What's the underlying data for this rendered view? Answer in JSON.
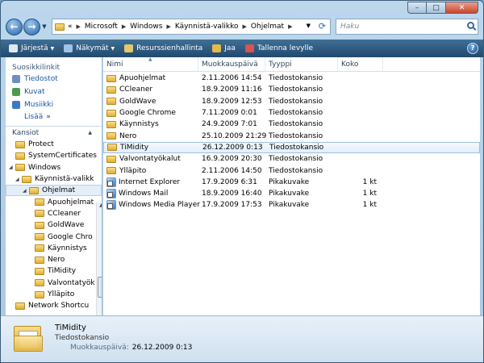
{
  "window": {
    "caption": {
      "minimize": "–",
      "maximize": "□",
      "close": "✕"
    }
  },
  "nav": {
    "back_label": "←",
    "forward_label": "→",
    "breadcrumb": [
      "Microsoft",
      "Windows",
      "Käynnistä-valikko",
      "Ohjelmat"
    ],
    "overflow": "«",
    "search_placeholder": "Haku"
  },
  "toolbar": {
    "items": [
      {
        "label": "Järjestä",
        "icon": "organize-icon",
        "color": "#dfe9f3",
        "caret": true
      },
      {
        "label": "Näkymät",
        "icon": "views-icon",
        "color": "#9ec3e6",
        "caret": true
      },
      {
        "label": "Resurssienhallinta",
        "icon": "explorer-icon",
        "color": "#e5c86d",
        "caret": false
      },
      {
        "label": "Jaa",
        "icon": "share-icon",
        "color": "#e8b84a",
        "caret": false
      },
      {
        "label": "Tallenna levylle",
        "icon": "burn-disc-icon",
        "color": "#d9534f",
        "caret": false
      }
    ],
    "help": "?"
  },
  "navpane": {
    "favorites_heading": "Suosikkilinkit",
    "favorites": [
      {
        "label": "Tiedostot",
        "color": "#6d8fbf"
      },
      {
        "label": "Kuvat",
        "color": "#4b9a4b"
      },
      {
        "label": "Musiikki",
        "color": "#3c78c6"
      }
    ],
    "more": "Lisää",
    "more_icon": "»",
    "folders_heading": "Kansiot",
    "tree": [
      {
        "label": "Protect",
        "indent": 1
      },
      {
        "label": "SystemCertificates",
        "indent": 1
      },
      {
        "label": "Windows",
        "indent": 1,
        "expanded": true
      },
      {
        "label": "Käynnistä-valikk",
        "indent": 2,
        "expanded": true
      },
      {
        "label": "Ohjelmat",
        "indent": 3,
        "selected": true,
        "expanded": true
      },
      {
        "label": "Apuohjelmat",
        "indent": 4
      },
      {
        "label": "CCleaner",
        "indent": 4
      },
      {
        "label": "GoldWave",
        "indent": 4
      },
      {
        "label": "Google Chro",
        "indent": 4
      },
      {
        "label": "Käynnistys",
        "indent": 4
      },
      {
        "label": "Nero",
        "indent": 4
      },
      {
        "label": "TiMidity",
        "indent": 4
      },
      {
        "label": "Valvontatyök",
        "indent": 4
      },
      {
        "label": "Ylläpito",
        "indent": 4
      },
      {
        "label": "Network Shortcu",
        "indent": 1
      }
    ]
  },
  "filelist": {
    "columns": [
      "Nimi",
      "Muokkauspäivä",
      "Tyyppi",
      "Koko"
    ],
    "rows": [
      {
        "name": "Apuohjelmat",
        "date": "2.11.2006 14:54",
        "type": "Tiedostokansio",
        "size": "",
        "kind": "folder"
      },
      {
        "name": "CCleaner",
        "date": "18.9.2009 11:16",
        "type": "Tiedostokansio",
        "size": "",
        "kind": "folder"
      },
      {
        "name": "GoldWave",
        "date": "18.9.2009 12:53",
        "type": "Tiedostokansio",
        "size": "",
        "kind": "folder"
      },
      {
        "name": "Google Chrome",
        "date": "7.11.2009 0:01",
        "type": "Tiedostokansio",
        "size": "",
        "kind": "folder"
      },
      {
        "name": "Käynnistys",
        "date": "24.9.2009 7:01",
        "type": "Tiedostokansio",
        "size": "",
        "kind": "folder"
      },
      {
        "name": "Nero",
        "date": "25.10.2009 21:29",
        "type": "Tiedostokansio",
        "size": "",
        "kind": "folder"
      },
      {
        "name": "TiMidity",
        "date": "26.12.2009 0:13",
        "type": "Tiedostokansio",
        "size": "",
        "kind": "folder",
        "selected": true
      },
      {
        "name": "Valvontatyökalut",
        "date": "16.9.2009 20:30",
        "type": "Tiedostokansio",
        "size": "",
        "kind": "folder"
      },
      {
        "name": "Ylläpito",
        "date": "2.11.2006 14:50",
        "type": "Tiedostokansio",
        "size": "",
        "kind": "folder"
      },
      {
        "name": "Internet Explorer",
        "date": "17.9.2009 6:31",
        "type": "Pikakuvake",
        "size": "1 kt",
        "kind": "shortcut"
      },
      {
        "name": "Windows Mail",
        "date": "18.9.2009 16:40",
        "type": "Pikakuvake",
        "size": "1 kt",
        "kind": "shortcut"
      },
      {
        "name": "Windows Media Player",
        "date": "17.9.2009 17:53",
        "type": "Pikakuvake",
        "size": "1 kt",
        "kind": "shortcut"
      }
    ]
  },
  "details": {
    "name": "TiMidity",
    "type": "Tiedostokansio",
    "date_label": "Muokkauspäivä:",
    "date_value": "26.12.2009 0:13"
  }
}
